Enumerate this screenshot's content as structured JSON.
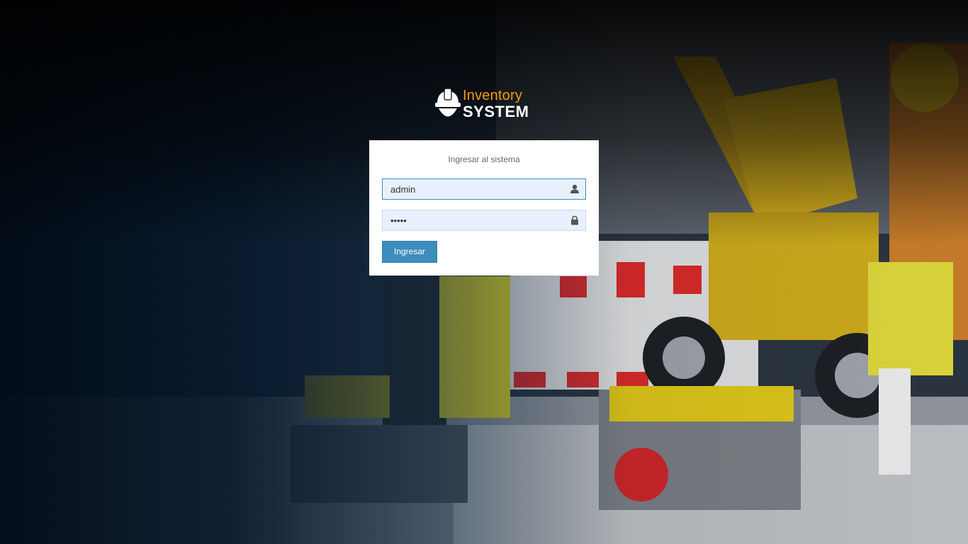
{
  "logo": {
    "line1": "Inventory",
    "line2": "SYSTEM",
    "accent_color": "#f39c12",
    "icon": "hard-hat-icon"
  },
  "login": {
    "message": "Ingresar al sistema",
    "username": {
      "value": "admin",
      "icon": "user-icon"
    },
    "password": {
      "value": "admin",
      "icon": "lock-icon"
    },
    "submit_label": "Ingresar",
    "button_color": "#3c8dbc"
  }
}
